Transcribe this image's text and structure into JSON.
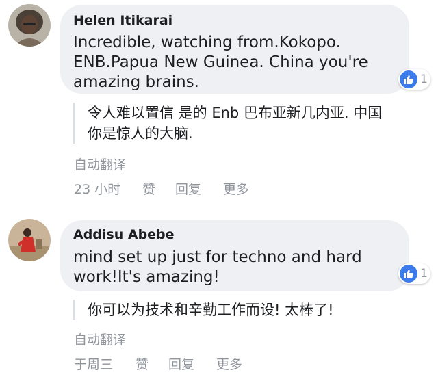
{
  "comments": [
    {
      "author": "Helen Itikarai",
      "text": "Incredible, watching from.Kokopo.\nENB.Papua New Guinea. China you're\namazing brains.",
      "reaction_count": "1",
      "translation": "令人难以置信 是的 Enb 巴布亚新几内亚. 中国\n你是惊人的大脑.",
      "auto_translate": "自动翻译",
      "time": "23 小时",
      "like_label": "赞",
      "reply_label": "回复",
      "more_label": "更多"
    },
    {
      "author": "Addisu Abebe",
      "text": "mind set up just for techno and hard\nwork!It's amazing!",
      "reaction_count": "1",
      "translation": "你可以为技术和辛勤工作而设! 太棒了!",
      "auto_translate": "自动翻译",
      "time": "于周三",
      "like_label": "赞",
      "reply_label": "回复",
      "more_label": "更多"
    }
  ],
  "colors": {
    "bubble": "#eef0f3",
    "like_blue": "#3b7bea",
    "meta_gray": "#90949c"
  }
}
